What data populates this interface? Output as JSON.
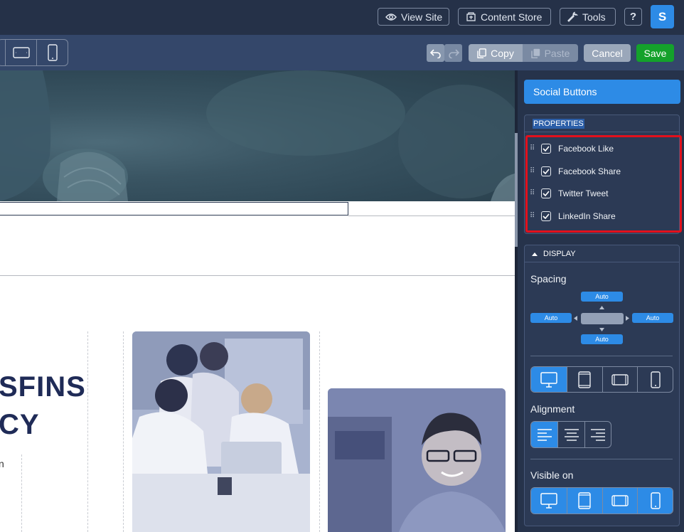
{
  "topbar": {
    "view_site": "View Site",
    "content_store": "Content Store",
    "tools": "Tools",
    "help": "?",
    "avatar_letter": "S"
  },
  "toolbar": {
    "copy": "Copy",
    "paste": "Paste",
    "cancel": "Cancel",
    "save": "Save"
  },
  "canvas": {
    "headline_line1": "SFINS",
    "headline_line2": "CY",
    "fragment": "n"
  },
  "panel": {
    "widget_title": "Social Buttons",
    "properties_header": "PROPERTIES",
    "properties": [
      {
        "label": "Facebook Like",
        "checked": true
      },
      {
        "label": "Facebook Share",
        "checked": true
      },
      {
        "label": "Twitter Tweet",
        "checked": true
      },
      {
        "label": "LinkedIn Share",
        "checked": true
      }
    ],
    "display_header": "DISPLAY",
    "spacing_label": "Spacing",
    "spacing": {
      "top": "Auto",
      "left": "Auto",
      "right": "Auto",
      "bottom": "Auto"
    },
    "devices": [
      "desktop-icon",
      "tablet-icon",
      "tablet-landscape-icon",
      "mobile-icon"
    ],
    "device_selected": "desktop",
    "alignment_label": "Alignment",
    "alignment_selected": "left",
    "visible_label": "Visible on",
    "visible_on": [
      "desktop",
      "tablet",
      "tablet-landscape",
      "mobile"
    ]
  },
  "colors": {
    "accent": "#2d8be6",
    "save": "#14a12b",
    "highlight": "#e3101c",
    "panel_bg": "#26334b",
    "headline": "#1f2b57"
  }
}
